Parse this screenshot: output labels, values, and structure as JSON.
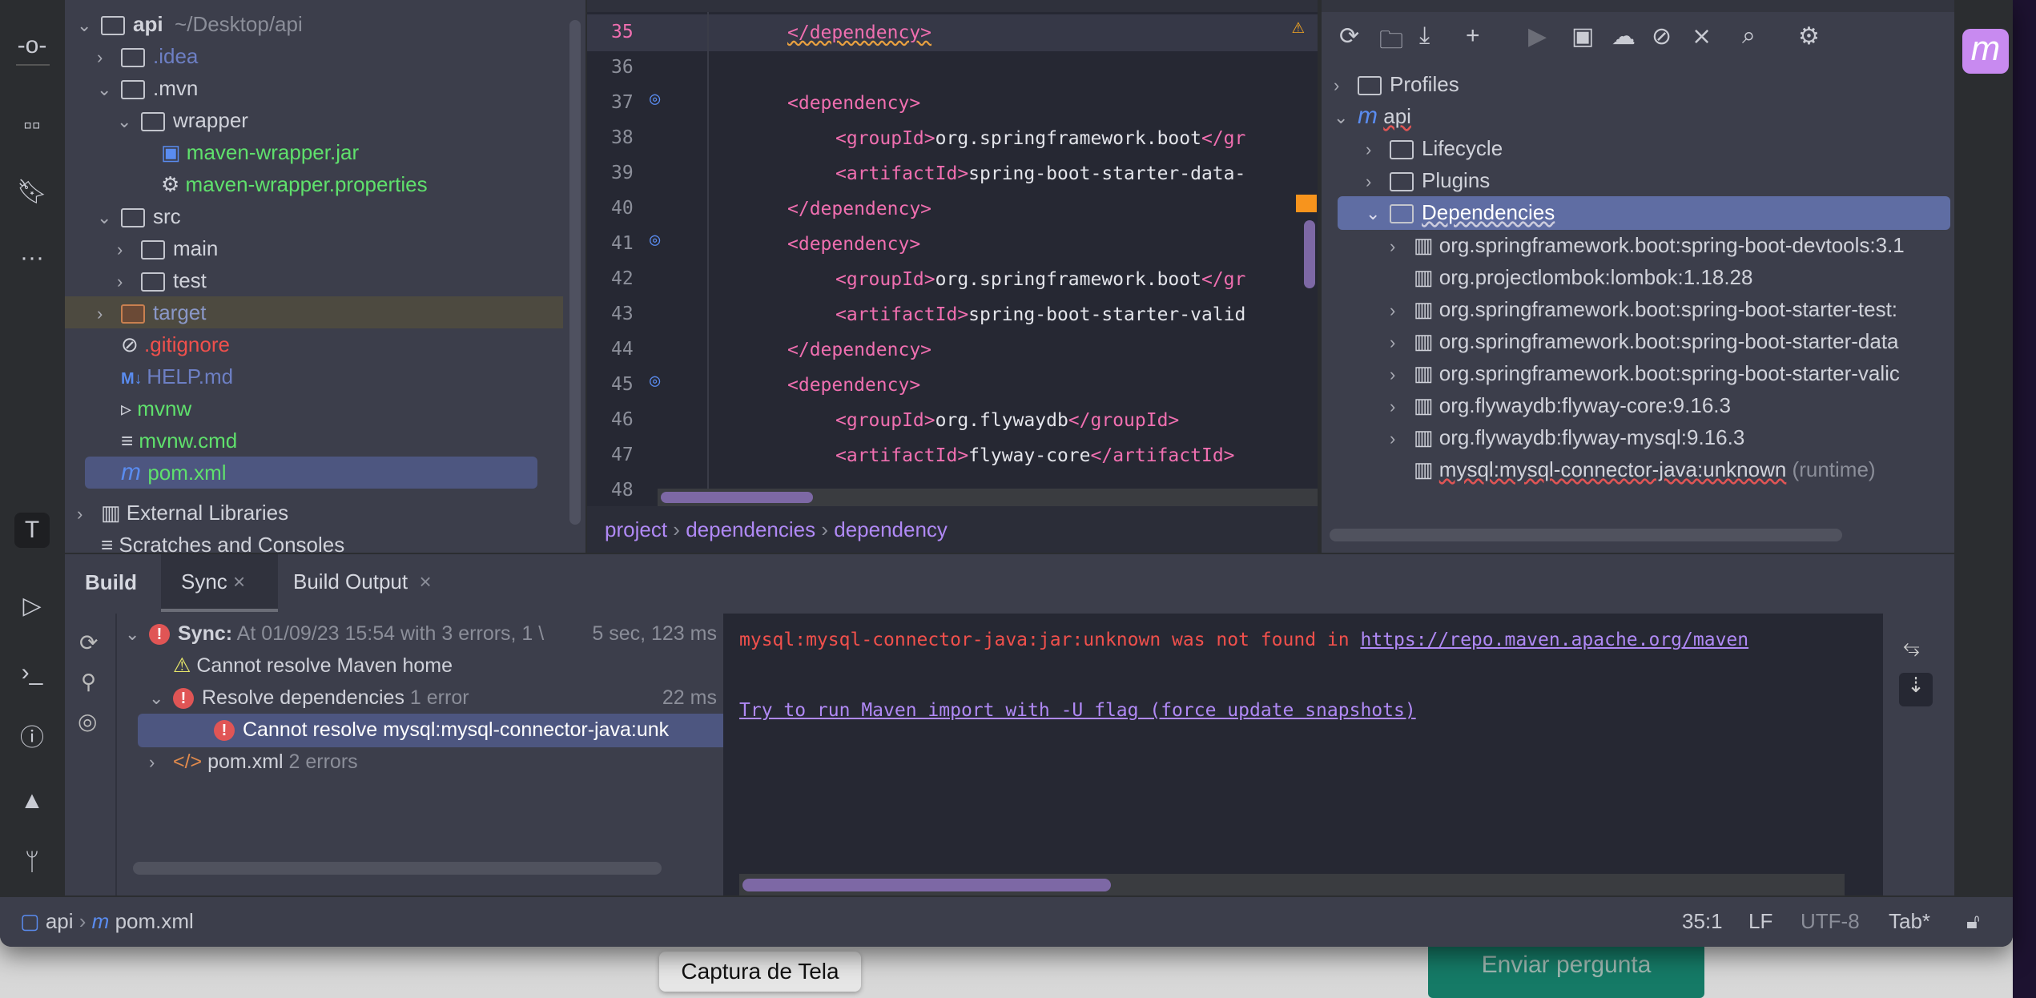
{
  "project": {
    "root": "api",
    "root_path": "~/Desktop/api",
    "items": [
      {
        "label": ".idea",
        "color": "#6d7fc4",
        "chev": "›"
      },
      {
        "label": ".mvn",
        "color": "#d0d2da",
        "chev": "⌄"
      },
      {
        "label": "wrapper",
        "color": "#d0d2da",
        "chev": "⌄"
      },
      {
        "label": "maven-wrapper.jar",
        "color": "#5fe06c",
        "chev": ""
      },
      {
        "label": "maven-wrapper.properties",
        "color": "#5fe06c",
        "chev": ""
      },
      {
        "label": "src",
        "color": "#d0d2da",
        "chev": "⌄"
      },
      {
        "label": "main",
        "color": "#d0d2da",
        "chev": "›"
      },
      {
        "label": "test",
        "color": "#d0d2da",
        "chev": "›"
      },
      {
        "label": "target",
        "color": "#8a98c8",
        "chev": "›"
      },
      {
        "label": ".gitignore",
        "color": "#f0504c",
        "chev": ""
      },
      {
        "label": "HELP.md",
        "color": "#6d7fc4",
        "chev": ""
      },
      {
        "label": "mvnw",
        "color": "#5fe06c",
        "chev": ""
      },
      {
        "label": "mvnw.cmd",
        "color": "#5fe06c",
        "chev": ""
      },
      {
        "label": "pom.xml",
        "color": "#5fe06c",
        "chev": ""
      }
    ],
    "external": "External Libraries",
    "scratches": "Scratches and Consoles"
  },
  "editor": {
    "lines": [
      {
        "n": "35",
        "indent": 1,
        "parts": [
          [
            "tag",
            "</dependency>"
          ]
        ]
      },
      {
        "n": "36",
        "indent": 0,
        "parts": []
      },
      {
        "n": "37",
        "indent": 1,
        "parts": [
          [
            "tag",
            "<dependency>"
          ]
        ],
        "gutter": true
      },
      {
        "n": "38",
        "indent": 2,
        "parts": [
          [
            "tag",
            "<groupId>"
          ],
          [
            "txt",
            "org.springframework.boot"
          ],
          [
            "tag",
            "</gr"
          ]
        ]
      },
      {
        "n": "39",
        "indent": 2,
        "parts": [
          [
            "tag",
            "<artifactId>"
          ],
          [
            "txt",
            "spring-boot-starter-data-"
          ]
        ]
      },
      {
        "n": "40",
        "indent": 1,
        "parts": [
          [
            "tag",
            "</dependency>"
          ]
        ]
      },
      {
        "n": "41",
        "indent": 1,
        "parts": [
          [
            "tag",
            "<dependency>"
          ]
        ],
        "gutter": true
      },
      {
        "n": "42",
        "indent": 2,
        "parts": [
          [
            "tag",
            "<groupId>"
          ],
          [
            "txt",
            "org.springframework.boot"
          ],
          [
            "tag",
            "</gr"
          ]
        ]
      },
      {
        "n": "43",
        "indent": 2,
        "parts": [
          [
            "tag",
            "<artifactId>"
          ],
          [
            "txt",
            "spring-boot-starter-valid"
          ]
        ]
      },
      {
        "n": "44",
        "indent": 1,
        "parts": [
          [
            "tag",
            "</dependency>"
          ]
        ]
      },
      {
        "n": "45",
        "indent": 1,
        "parts": [
          [
            "tag",
            "<dependency>"
          ]
        ],
        "gutter": true
      },
      {
        "n": "46",
        "indent": 2,
        "parts": [
          [
            "tag",
            "<groupId>"
          ],
          [
            "txt",
            "org.flywaydb"
          ],
          [
            "tag",
            "</groupId>"
          ]
        ]
      },
      {
        "n": "47",
        "indent": 2,
        "parts": [
          [
            "tag",
            "<artifactId>"
          ],
          [
            "txt",
            "flyway-core"
          ],
          [
            "tag",
            "</artifactId>"
          ]
        ]
      },
      {
        "n": "48",
        "indent": 1,
        "parts": []
      }
    ],
    "breadcrumb": [
      "project",
      "dependencies",
      "dependency"
    ]
  },
  "maven": {
    "profiles": "Profiles",
    "project": "api",
    "lifecycle": "Lifecycle",
    "plugins": "Plugins",
    "dependencies": "Dependencies",
    "deps": [
      {
        "label": "org.springframework.boot:spring-boot-devtools:3.1",
        "chev": true
      },
      {
        "label": "org.projectlombok:lombok:1.18.28",
        "chev": false
      },
      {
        "label": "org.springframework.boot:spring-boot-starter-test:",
        "chev": true
      },
      {
        "label": "org.springframework.boot:spring-boot-starter-data",
        "chev": true
      },
      {
        "label": "org.springframework.boot:spring-boot-starter-valic",
        "chev": true
      },
      {
        "label": "org.flywaydb:flyway-core:9.16.3",
        "chev": true
      },
      {
        "label": "org.flywaydb:flyway-mysql:9.16.3",
        "chev": true
      },
      {
        "label": "mysql:mysql-connector-java:unknown",
        "chev": false,
        "suffix": "(runtime)"
      }
    ]
  },
  "build": {
    "title": "Build",
    "tabs": [
      "Sync",
      "Build Output"
    ],
    "sync_label": "Sync:",
    "sync_detail": "At 01/09/23 15:54 with 3 errors, 1 \\",
    "sync_time": "5 sec, 123 ms",
    "warn": "Cannot resolve Maven home",
    "resolve": "Resolve dependencies",
    "resolve_count": "1 error",
    "resolve_time": "22 ms",
    "selected": "Cannot resolve mysql:mysql-connector-java:unk",
    "pom": "pom.xml",
    "pom_count": "2 errors",
    "console_err": "mysql:mysql-connector-java:jar:unknown was not found in ",
    "console_link": "https://repo.maven.apache.org/maven",
    "console_hint": "Try to run Maven import with -U flag (force update snapshots)"
  },
  "status": {
    "crumb_root": "api",
    "crumb_file": "pom.xml",
    "position": "35:1",
    "line_sep": "LF",
    "encoding": "UTF-8",
    "indent": "Tab*"
  },
  "desktop": {
    "tooltip": "Captura de Tela",
    "button": "Enviar pergunta"
  },
  "colors": {
    "accent": "#5f6da3",
    "error": "#e05555",
    "tag": "#f06fb0",
    "link": "#b089f5",
    "vcs_added": "#5fe06c"
  }
}
